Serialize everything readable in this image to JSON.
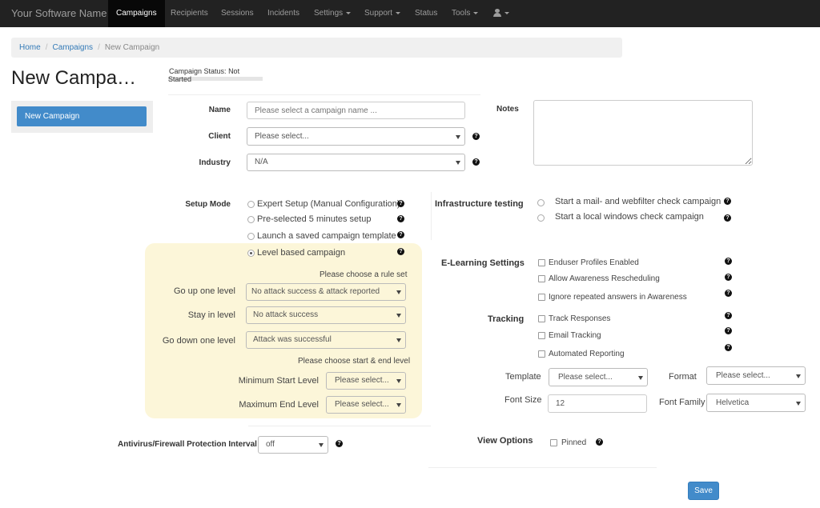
{
  "nav": {
    "brand": "Your Software Name",
    "items": [
      {
        "label": "Campaigns",
        "active": true
      },
      {
        "label": "Recipients"
      },
      {
        "label": "Sessions"
      },
      {
        "label": "Incidents"
      },
      {
        "label": "Settings",
        "dropdown": true
      },
      {
        "label": "Support",
        "dropdown": true
      },
      {
        "label": "Status"
      },
      {
        "label": "Tools",
        "dropdown": true
      }
    ],
    "user_icon": "user-icon"
  },
  "breadcrumb": {
    "home": "Home",
    "campaigns": "Campaigns",
    "current": "New Campaign",
    "separator": "/"
  },
  "page": {
    "title": "New Campa…",
    "status_label": "Campaign Status:",
    "status_value": "Not Started",
    "side_button": "New Campaign"
  },
  "form": {
    "name_label": "Name",
    "name_placeholder": "Please select a campaign name ...",
    "client_label": "Client",
    "client_value": "Please select...",
    "industry_label": "Industry",
    "industry_value": "N/A",
    "notes_label": "Notes",
    "setup_mode_label": "Setup Mode",
    "setup_options": [
      {
        "label": "Expert Setup (Manual Configuration)",
        "checked": false
      },
      {
        "label": "Pre-selected 5 minutes setup",
        "checked": false
      },
      {
        "label": "Launch a saved campaign template",
        "checked": false
      },
      {
        "label": "Level based campaign",
        "checked": true
      }
    ],
    "level": {
      "rule_hint": "Please choose a rule set",
      "go_up_label": "Go up one level",
      "go_up_value": "No attack success & attack reported",
      "stay_label": "Stay in level",
      "stay_value": "No attack success",
      "go_down_label": "Go down one level",
      "go_down_value": "Attack was successful",
      "start_end_hint": "Please choose start & end level",
      "min_label": "Minimum Start Level",
      "min_value": "Please select...",
      "max_label": "Maximum End Level",
      "max_value": "Please select..."
    },
    "av_label": "Antivirus/Firewall Protection Interval",
    "av_value": "off",
    "infra_label": "Infrastructure testing",
    "infra_options": [
      {
        "label": "Start a mail- and webfilter check campaign"
      },
      {
        "label": "Start a local windows check campaign"
      }
    ],
    "elearning_label": "E-Learning Settings",
    "elearning_options": [
      {
        "label": "Enduser Profiles Enabled"
      },
      {
        "label": "Allow Awareness Rescheduling"
      },
      {
        "label": "Ignore repeated answers in Awareness"
      }
    ],
    "tracking_label": "Tracking",
    "tracking_options": [
      {
        "label": "Track Responses"
      },
      {
        "label": "Email Tracking"
      },
      {
        "label": "Automated Reporting"
      }
    ],
    "template_label": "Template",
    "template_value": "Please select...",
    "format_label": "Format",
    "format_value": "Please select...",
    "font_size_label": "Font Size",
    "font_size_value": "12",
    "font_family_label": "Font Family",
    "font_family_value": "Helvetica",
    "view_options_label": "View Options",
    "pinned_label": "Pinned",
    "save_label": "Save",
    "help_glyph": "?"
  },
  "colors": {
    "navbar": "#222222",
    "primary": "#428bca",
    "level_panel": "#fcf6d9"
  }
}
